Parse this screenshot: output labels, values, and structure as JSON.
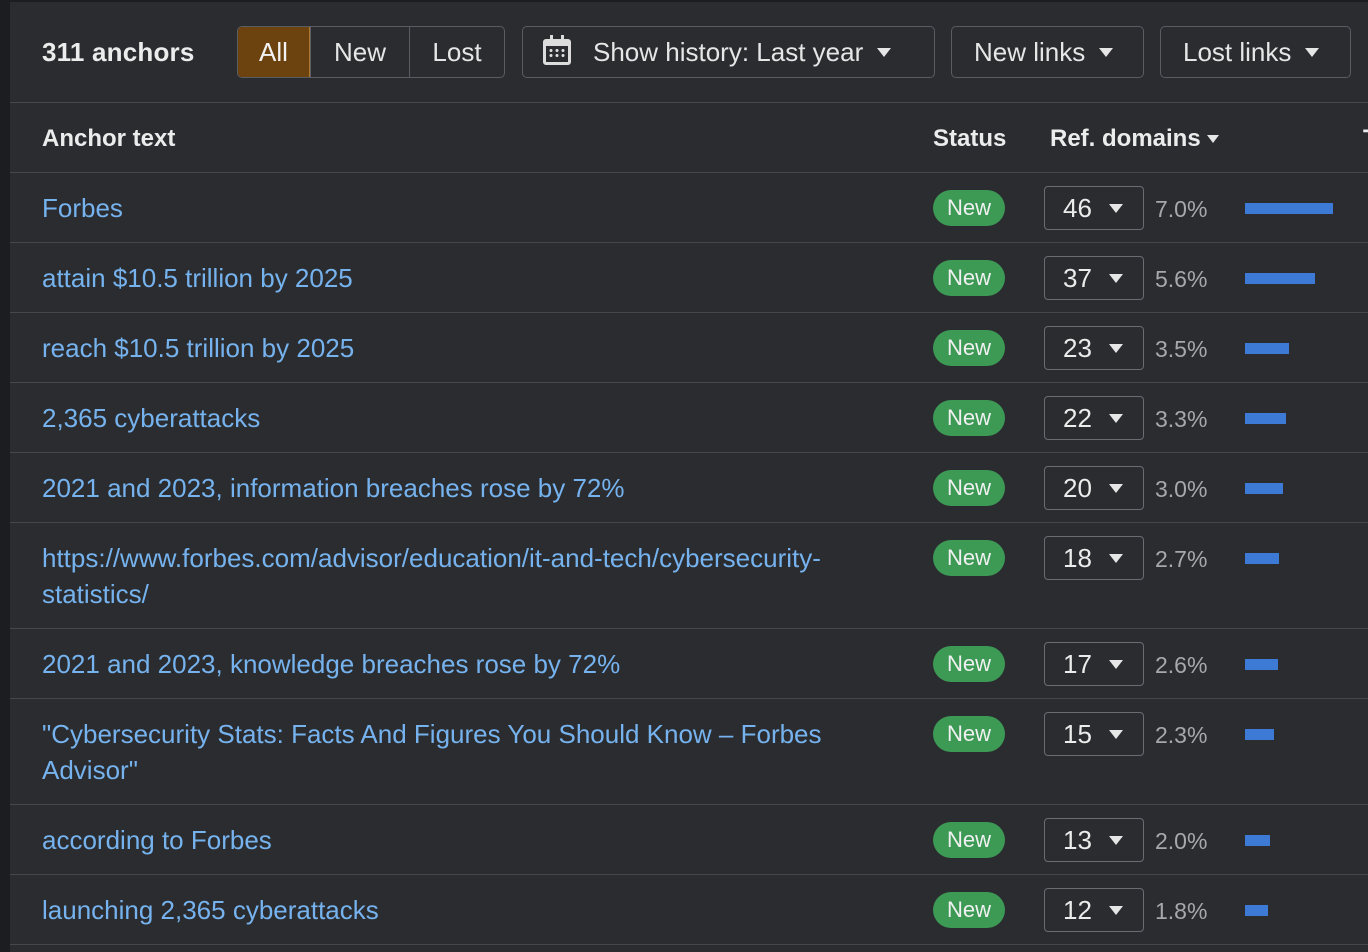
{
  "toolbar": {
    "anchor_count": "311 anchors",
    "filter_tabs": [
      {
        "label": "All",
        "active": true
      },
      {
        "label": "New",
        "active": false
      },
      {
        "label": "Lost",
        "active": false
      }
    ],
    "history_label": "Show history: Last year",
    "new_links_label": "New links",
    "lost_links_label": "Lost links",
    "calendar_icon": "calendar-icon"
  },
  "table": {
    "headers": {
      "anchor": "Anchor text",
      "status": "Status",
      "ref_domains": "Ref. domains",
      "extra": "T"
    },
    "rows": [
      {
        "anchor": "Forbes",
        "status": "New",
        "ref_domains": "46",
        "percent": "7.0%",
        "share": 7.0
      },
      {
        "anchor": "attain $10.5 trillion by 2025",
        "status": "New",
        "ref_domains": "37",
        "percent": "5.6%",
        "share": 5.6
      },
      {
        "anchor": "reach $10.5 trillion by 2025",
        "status": "New",
        "ref_domains": "23",
        "percent": "3.5%",
        "share": 3.5
      },
      {
        "anchor": "2,365 cyberattacks",
        "status": "New",
        "ref_domains": "22",
        "percent": "3.3%",
        "share": 3.3
      },
      {
        "anchor": "2021 and 2023, information breaches rose by 72%",
        "status": "New",
        "ref_domains": "20",
        "percent": "3.0%",
        "share": 3.0
      },
      {
        "anchor": "https://www.forbes.com/advisor/education/it-and-tech/cybersecurity-statistics/",
        "status": "New",
        "ref_domains": "18",
        "percent": "2.7%",
        "share": 2.7
      },
      {
        "anchor": "2021 and 2023, knowledge breaches rose by 72%",
        "status": "New",
        "ref_domains": "17",
        "percent": "2.6%",
        "share": 2.6
      },
      {
        "anchor": "\"Cybersecurity Stats: Facts And Figures You Should Know – Forbes Advisor\"",
        "status": "New",
        "ref_domains": "15",
        "percent": "2.3%",
        "share": 2.3
      },
      {
        "anchor": "according to Forbes",
        "status": "New",
        "ref_domains": "13",
        "percent": "2.0%",
        "share": 2.0
      },
      {
        "anchor": "launching 2,365 cyberattacks",
        "status": "New",
        "ref_domains": "12",
        "percent": "1.8%",
        "share": 1.8
      }
    ]
  },
  "colors": {
    "background": "#2a2c30",
    "link": "#76b3ee",
    "badge_new": "#3c9a55",
    "active_tab": "#6c420f",
    "bar": "#3d7ad6"
  }
}
